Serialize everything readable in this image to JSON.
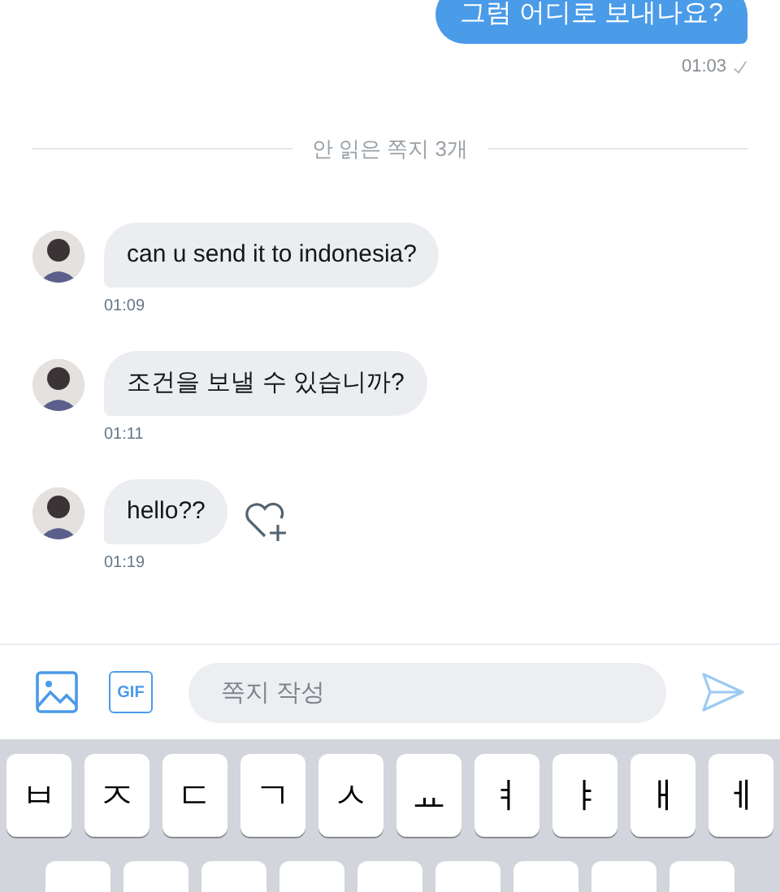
{
  "messages_before": [
    {
      "kind": "sent",
      "text": "그럼 어디로 보내나요?",
      "time": "01:03",
      "read": true
    }
  ],
  "divider": "안 읽은 쪽지 3개",
  "messages": [
    {
      "kind": "received",
      "text": "can u send it to indonesia?",
      "time": "01:09",
      "heart": false
    },
    {
      "kind": "received",
      "text": "조건을 보낼 수 있습니까?",
      "time": "01:11",
      "heart": false
    },
    {
      "kind": "received",
      "text": "hello??",
      "time": "01:19",
      "heart": true
    }
  ],
  "composer": {
    "gif_label": "GIF",
    "placeholder": "쪽지 작성"
  },
  "keyboard": {
    "row_1": [
      "ㅂ",
      "ㅈ",
      "ㄷ",
      "ㄱ",
      "ㅅ",
      "ㅛ",
      "ㅕ",
      "ㅑ",
      "ㅐ",
      "ㅔ"
    ]
  }
}
